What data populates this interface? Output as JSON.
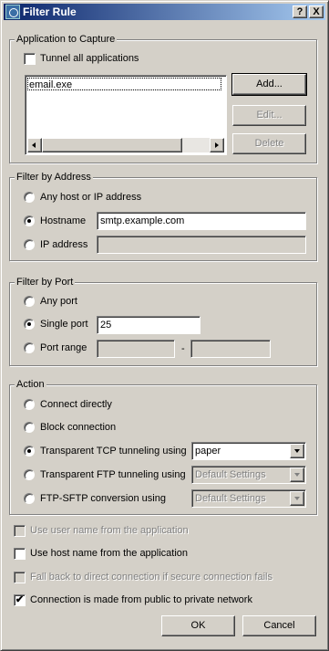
{
  "window": {
    "title": "Filter Rule",
    "help_glyph": "?",
    "close_glyph": "X",
    "icon": "app-icon"
  },
  "app_group": {
    "legend": "Application to Capture",
    "tunnel_all_label": "Tunnel all applications",
    "tunnel_all_checked": false,
    "items": [
      "email.exe"
    ],
    "add_label": "Add...",
    "edit_label": "Edit...",
    "delete_label": "Delete"
  },
  "address_group": {
    "legend": "Filter by Address",
    "any_label": "Any host or IP address",
    "hostname_label": "Hostname",
    "hostname_value": "smtp.example.com",
    "ip_label": "IP address",
    "ip_value": "",
    "selected": "hostname"
  },
  "port_group": {
    "legend": "Filter by Port",
    "any_label": "Any port",
    "single_label": "Single port",
    "single_value": "25",
    "range_label": "Port range",
    "range_sep": "-",
    "range_from": "",
    "range_to": "",
    "selected": "single"
  },
  "action_group": {
    "legend": "Action",
    "connect_label": "Connect directly",
    "block_label": "Block connection",
    "tcp_label": "Transparent TCP tunneling using",
    "tcp_value": "paper",
    "ftp_label": "Transparent FTP tunneling using",
    "ftp_value": "Default Settings",
    "sftp_label": "FTP-SFTP conversion using",
    "sftp_value": "Default Settings",
    "selected": "tcp"
  },
  "options": {
    "use_user_label": "Use user name from the application",
    "use_user_checked": false,
    "use_host_label": "Use host name from the application",
    "use_host_checked": false,
    "fallback_label": "Fall back to direct connection if secure connection fails",
    "fallback_checked": false,
    "public_private_label": "Connection is made from public to private network",
    "public_private_checked": true,
    "check_glyph": "✔"
  },
  "footer": {
    "ok_label": "OK",
    "cancel_label": "Cancel"
  }
}
